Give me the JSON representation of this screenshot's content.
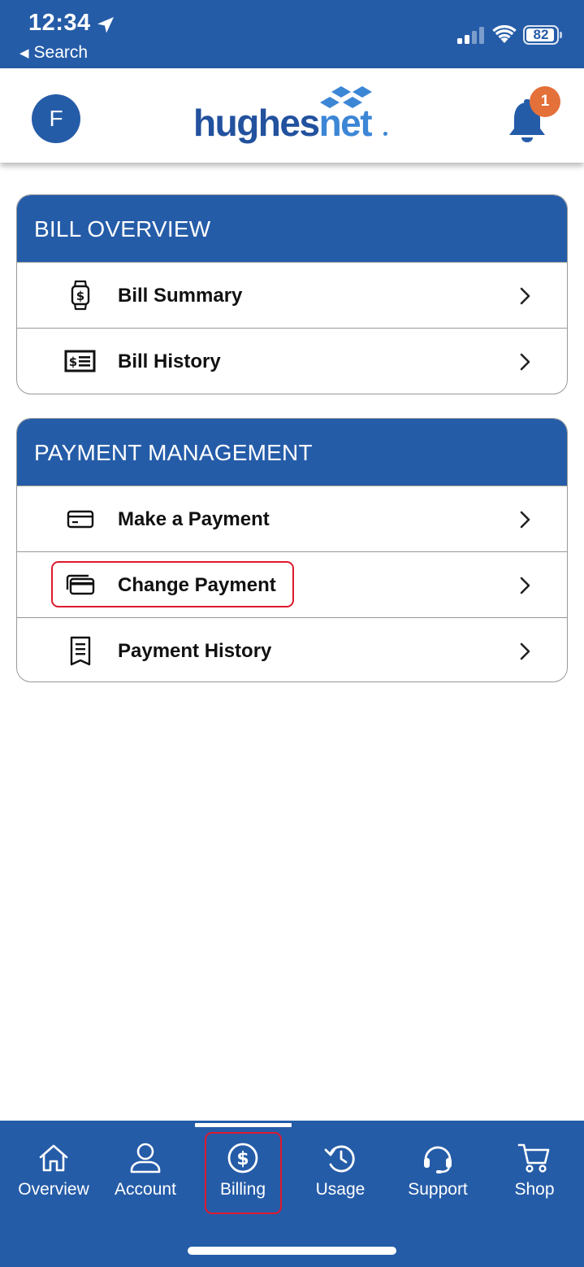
{
  "status_bar": {
    "time": "12:34",
    "back_label": "Search",
    "battery": "82"
  },
  "header": {
    "avatar_initial": "F",
    "logo_text_1": "hughes",
    "logo_text_2": "net",
    "notification_count": "1"
  },
  "bill_overview": {
    "title": "BILL OVERVIEW",
    "items": [
      {
        "label": "Bill Summary",
        "icon": "watch-bill-icon"
      },
      {
        "label": "Bill History",
        "icon": "bill-list-icon"
      }
    ]
  },
  "payment_management": {
    "title": "PAYMENT MANAGEMENT",
    "items": [
      {
        "label": "Make a Payment",
        "icon": "credit-card-icon"
      },
      {
        "label": "Change Payment",
        "icon": "cards-icon"
      },
      {
        "label": "Payment History",
        "icon": "receipt-icon"
      }
    ]
  },
  "bottom_nav": {
    "items": [
      {
        "label": "Overview",
        "icon": "home-icon"
      },
      {
        "label": "Account",
        "icon": "user-icon"
      },
      {
        "label": "Billing",
        "icon": "dollar-circle-icon"
      },
      {
        "label": "Usage",
        "icon": "history-icon"
      },
      {
        "label": "Support",
        "icon": "headset-icon"
      },
      {
        "label": "Shop",
        "icon": "cart-icon"
      }
    ],
    "active": "Billing"
  },
  "colors": {
    "brand_blue": "#255ca8",
    "logo_blue_light": "#3c86d6",
    "badge_orange": "#e4703a",
    "highlight_red": "#de1a2d"
  }
}
